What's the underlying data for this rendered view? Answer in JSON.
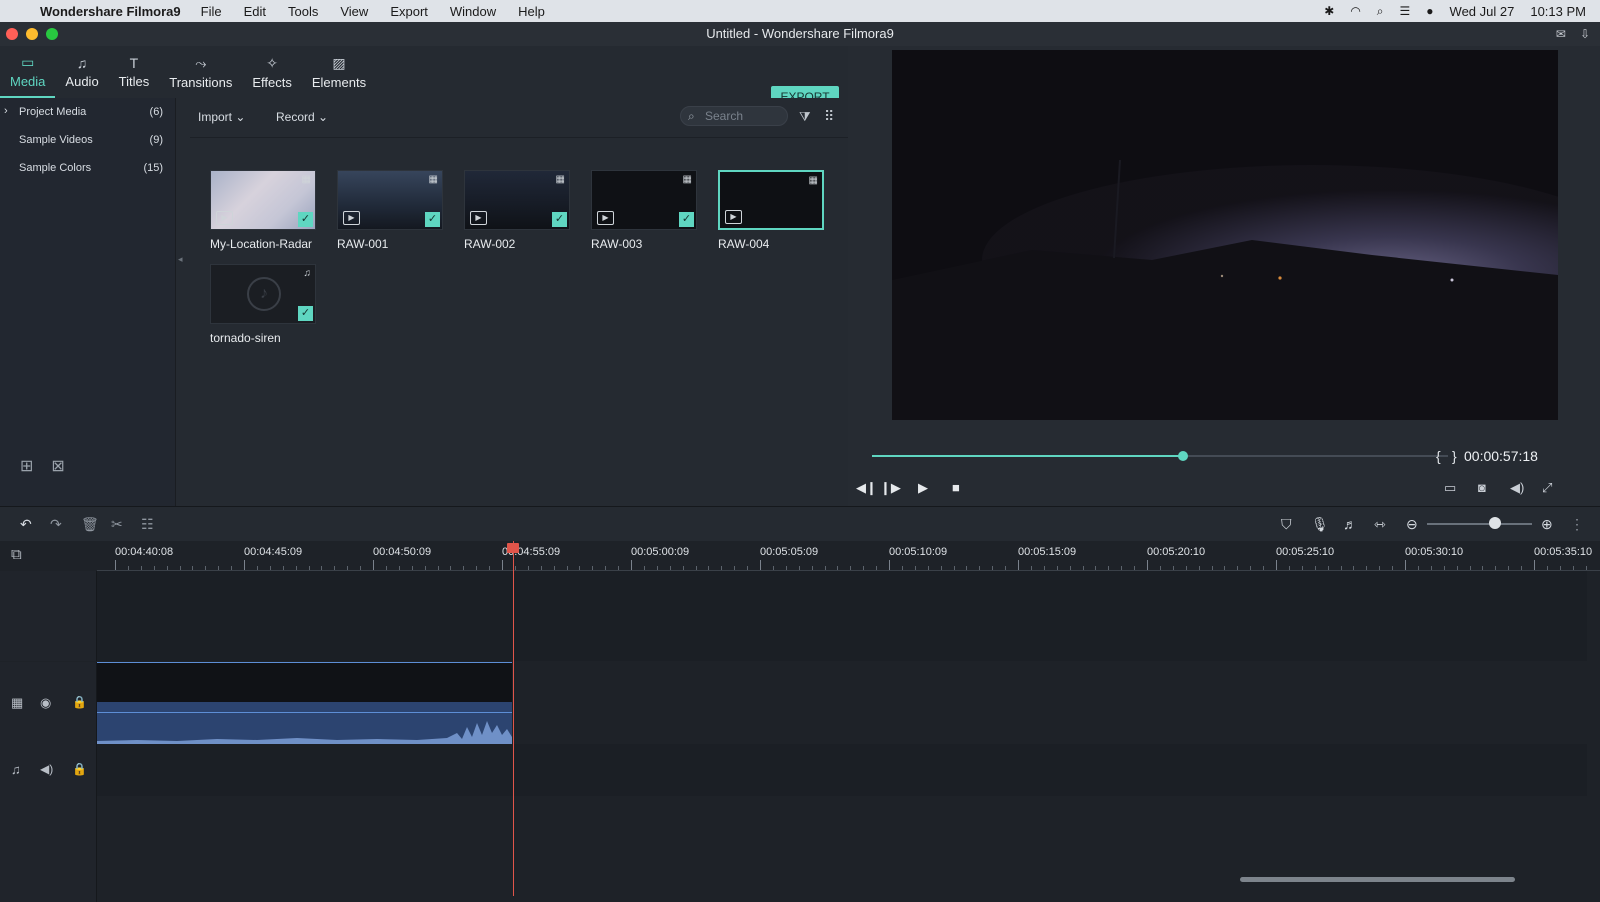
{
  "menubar": {
    "app_name": "Wondershare Filmora9",
    "items": [
      "File",
      "Edit",
      "Tools",
      "View",
      "Export",
      "Window",
      "Help"
    ],
    "datetime_day": "Wed Jul 27",
    "datetime_time": "10:13 PM"
  },
  "window": {
    "title": "Untitled - Wondershare Filmora9"
  },
  "tabs": [
    {
      "label": "Media",
      "icon": "folder-icon",
      "active": true
    },
    {
      "label": "Audio",
      "icon": "music-note-icon"
    },
    {
      "label": "Titles",
      "icon": "text-icon"
    },
    {
      "label": "Transitions",
      "icon": "transition-icon"
    },
    {
      "label": "Effects",
      "icon": "effects-icon"
    },
    {
      "label": "Elements",
      "icon": "image-icon"
    }
  ],
  "export_label": "EXPORT",
  "sidebar": {
    "items": [
      {
        "label": "Project Media",
        "count": "(6)"
      },
      {
        "label": "Sample Videos",
        "count": "(9)"
      },
      {
        "label": "Sample Colors",
        "count": "(15)"
      }
    ]
  },
  "media_toolbar": {
    "import_label": "Import",
    "record_label": "Record",
    "search_placeholder": "Search"
  },
  "clips": [
    {
      "name": "My-Location-Radar",
      "type": "video",
      "checked": true
    },
    {
      "name": "RAW-001",
      "type": "video",
      "checked": true
    },
    {
      "name": "RAW-002",
      "type": "video",
      "checked": true
    },
    {
      "name": "RAW-003",
      "type": "video",
      "checked": true
    },
    {
      "name": "RAW-004",
      "type": "video",
      "selected": true
    },
    {
      "name": "tornado-siren",
      "type": "audio",
      "checked": true
    }
  ],
  "preview": {
    "timecode": "00:00:57:18",
    "progress": 0.54
  },
  "timeline": {
    "ruler_labels": [
      "00:04:40:08",
      "00:04:45:09",
      "00:04:50:09",
      "00:04:55:09",
      "00:05:00:09",
      "00:05:05:09",
      "00:05:10:09",
      "00:05:15:09",
      "00:05:20:10",
      "00:05:25:10",
      "00:05:30:10",
      "00:05:35:10"
    ]
  },
  "colors": {
    "accent": "#5fd6c1",
    "playhead": "#e0554a",
    "clip_blue": "#2c4470"
  }
}
